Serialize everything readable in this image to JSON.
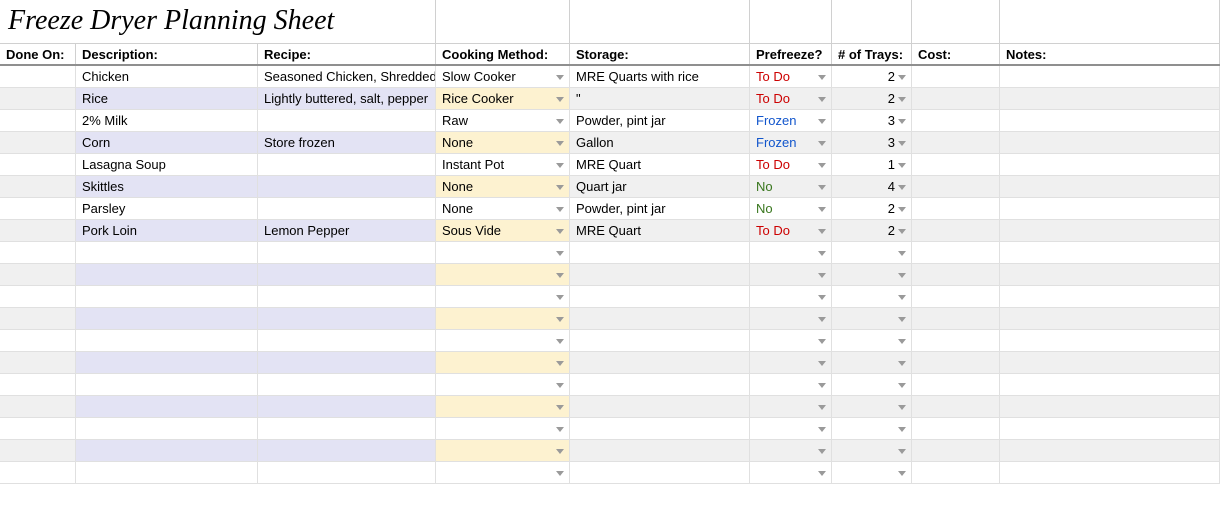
{
  "title": "Freeze Dryer Planning Sheet",
  "headers": {
    "done": "Done On:",
    "desc": "Description:",
    "recipe": "Recipe:",
    "cook": "Cooking Method:",
    "store": "Storage:",
    "pre": "Prefreeze?",
    "trays": "# of Trays:",
    "cost": "Cost:",
    "notes": "Notes:"
  },
  "prefreeze_color_map": {
    "To Do": "pf-todo",
    "Frozen": "pf-frozen",
    "No": "pf-no"
  },
  "rows": [
    {
      "done": "",
      "desc": "Chicken",
      "recipe": "Seasoned Chicken, Shredded",
      "cook": "Slow Cooker",
      "store": "MRE Quarts with rice",
      "pre": "To Do",
      "trays": "2",
      "cost": "",
      "notes": ""
    },
    {
      "done": "",
      "desc": "Rice",
      "recipe": "Lightly buttered, salt, pepper",
      "cook": "Rice Cooker",
      "store": "\"",
      "pre": "To Do",
      "trays": "2",
      "cost": "",
      "notes": ""
    },
    {
      "done": "",
      "desc": "2% Milk",
      "recipe": "",
      "cook": "Raw",
      "store": "Powder, pint jar",
      "pre": "Frozen",
      "trays": "3",
      "cost": "",
      "notes": ""
    },
    {
      "done": "",
      "desc": "Corn",
      "recipe": "Store frozen",
      "cook": "None",
      "store": "Gallon",
      "pre": "Frozen",
      "trays": "3",
      "cost": "",
      "notes": ""
    },
    {
      "done": "",
      "desc": "Lasagna Soup",
      "recipe": "",
      "cook": "Instant Pot",
      "store": "MRE Quart",
      "pre": "To Do",
      "trays": "1",
      "cost": "",
      "notes": ""
    },
    {
      "done": "",
      "desc": "Skittles",
      "recipe": "",
      "cook": "None",
      "store": "Quart jar",
      "pre": "No",
      "trays": "4",
      "cost": "",
      "notes": ""
    },
    {
      "done": "",
      "desc": "Parsley",
      "recipe": "",
      "cook": "None",
      "store": "Powder, pint jar",
      "pre": "No",
      "trays": "2",
      "cost": "",
      "notes": ""
    },
    {
      "done": "",
      "desc": "Pork Loin",
      "recipe": "Lemon Pepper",
      "cook": "Sous Vide",
      "store": "MRE Quart",
      "pre": "To Do",
      "trays": "2",
      "cost": "",
      "notes": ""
    },
    {
      "done": "",
      "desc": "",
      "recipe": "",
      "cook": "",
      "store": "",
      "pre": "",
      "trays": "",
      "cost": "",
      "notes": ""
    },
    {
      "done": "",
      "desc": "",
      "recipe": "",
      "cook": "",
      "store": "",
      "pre": "",
      "trays": "",
      "cost": "",
      "notes": ""
    },
    {
      "done": "",
      "desc": "",
      "recipe": "",
      "cook": "",
      "store": "",
      "pre": "",
      "trays": "",
      "cost": "",
      "notes": ""
    },
    {
      "done": "",
      "desc": "",
      "recipe": "",
      "cook": "",
      "store": "",
      "pre": "",
      "trays": "",
      "cost": "",
      "notes": ""
    },
    {
      "done": "",
      "desc": "",
      "recipe": "",
      "cook": "",
      "store": "",
      "pre": "",
      "trays": "",
      "cost": "",
      "notes": ""
    },
    {
      "done": "",
      "desc": "",
      "recipe": "",
      "cook": "",
      "store": "",
      "pre": "",
      "trays": "",
      "cost": "",
      "notes": ""
    },
    {
      "done": "",
      "desc": "",
      "recipe": "",
      "cook": "",
      "store": "",
      "pre": "",
      "trays": "",
      "cost": "",
      "notes": ""
    },
    {
      "done": "",
      "desc": "",
      "recipe": "",
      "cook": "",
      "store": "",
      "pre": "",
      "trays": "",
      "cost": "",
      "notes": ""
    },
    {
      "done": "",
      "desc": "",
      "recipe": "",
      "cook": "",
      "store": "",
      "pre": "",
      "trays": "",
      "cost": "",
      "notes": ""
    },
    {
      "done": "",
      "desc": "",
      "recipe": "",
      "cook": "",
      "store": "",
      "pre": "",
      "trays": "",
      "cost": "",
      "notes": ""
    },
    {
      "done": "",
      "desc": "",
      "recipe": "",
      "cook": "",
      "store": "",
      "pre": "",
      "trays": "",
      "cost": "",
      "notes": ""
    }
  ]
}
